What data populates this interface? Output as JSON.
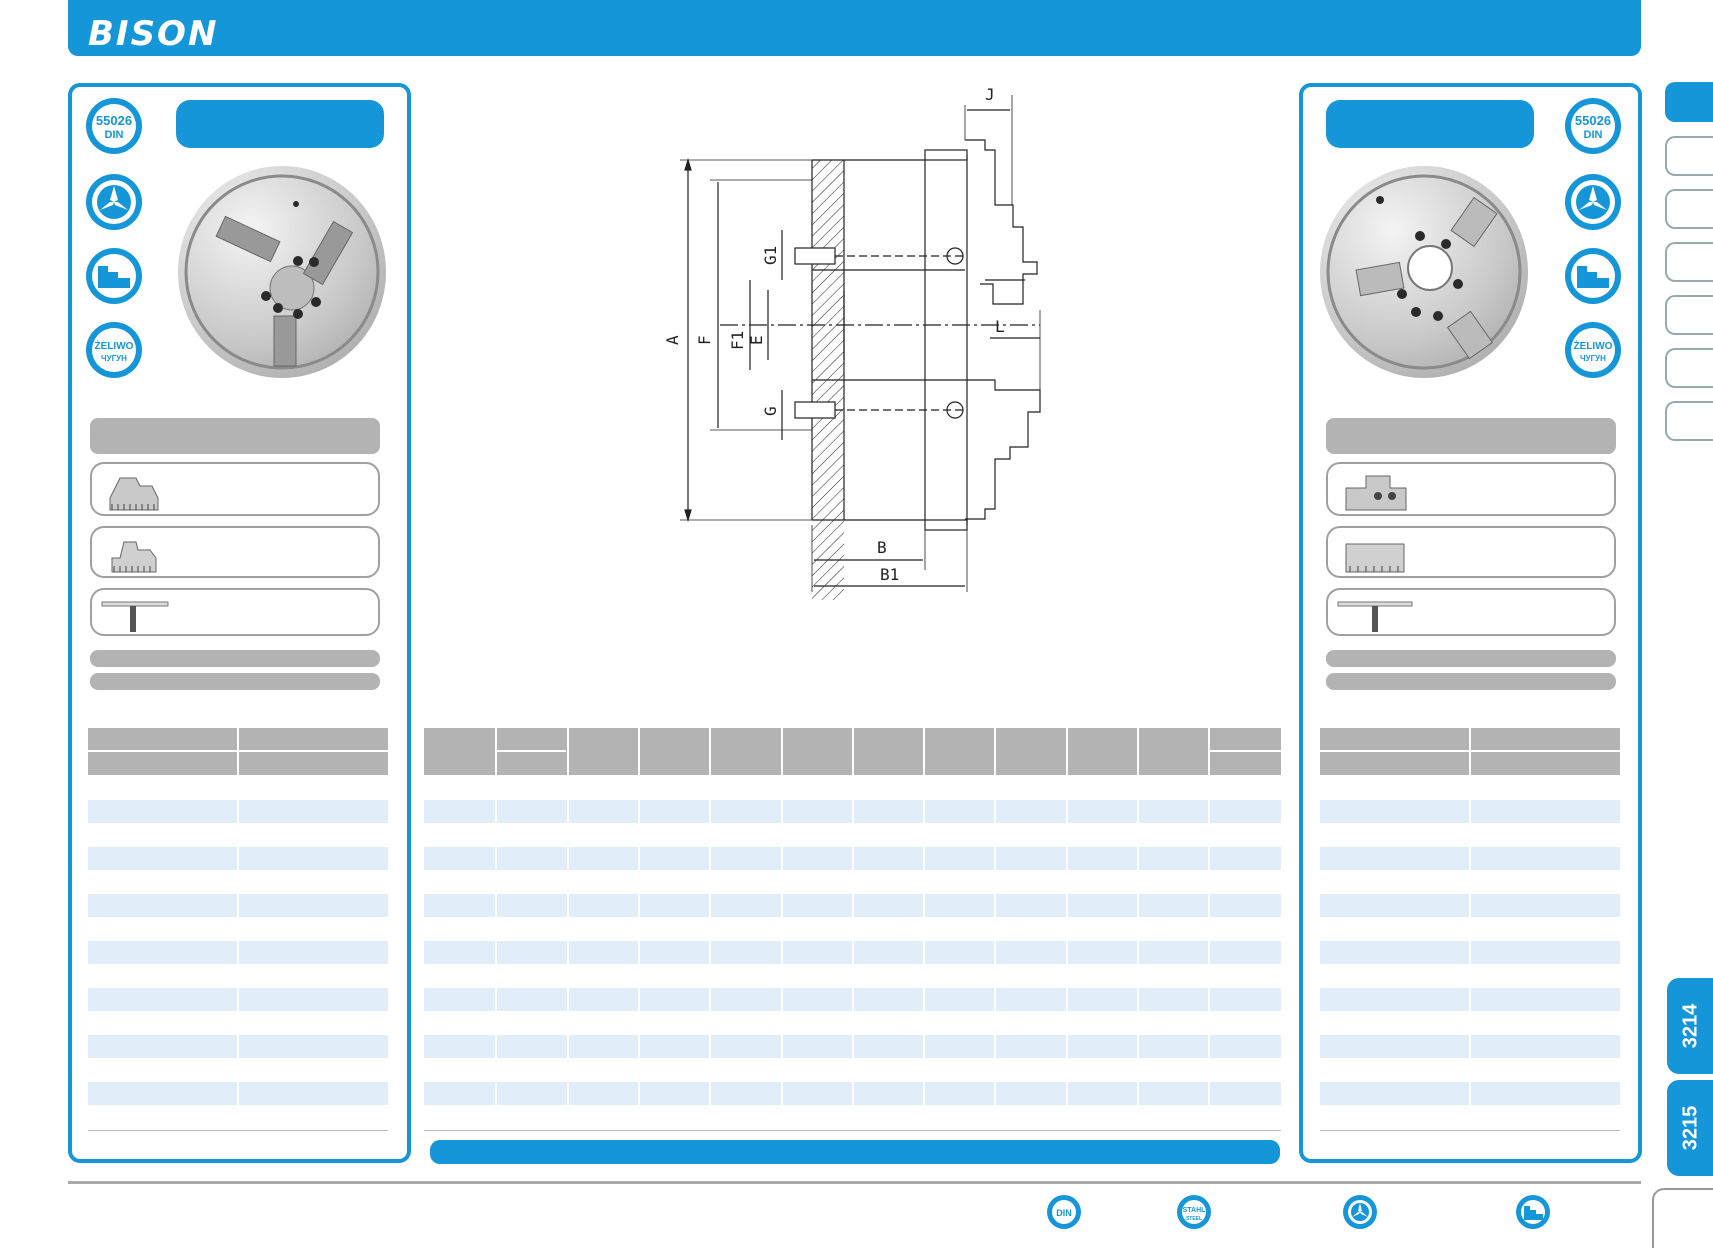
{
  "header": {
    "brand": "BISON"
  },
  "badges": {
    "din": "55026",
    "din_sub": "DIN",
    "zeliwo": "ŻELIWO",
    "zeliwo_sub": "ЧУГУН",
    "stahl": "STAHL",
    "stahl_sub": "STEEL"
  },
  "drawing": {
    "labels": {
      "J": "J",
      "A": "A",
      "F": "F",
      "F1": "F1",
      "E": "E",
      "G1": "G1",
      "G": "G",
      "L": "L",
      "B": "B",
      "B1": "B1"
    }
  },
  "side_tabs": {
    "tab_3214": "3214",
    "tab_3215": "3215"
  },
  "colors": {
    "accent": "#1596d8",
    "grey": "#b3b3b3",
    "row_alt": "#e1eef9"
  }
}
